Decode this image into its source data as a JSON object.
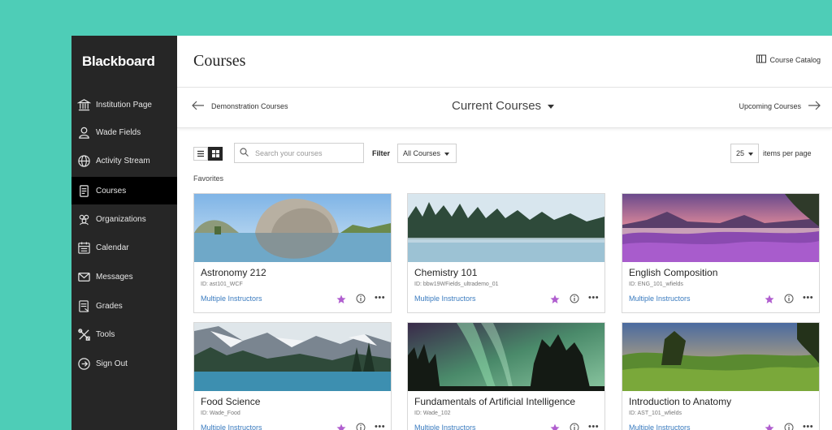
{
  "app": {
    "brand": "Blackboard"
  },
  "sidebar": {
    "items": [
      {
        "label": "Institution Page",
        "icon": "bank-icon"
      },
      {
        "label": "Wade Fields",
        "icon": "user-icon"
      },
      {
        "label": "Activity Stream",
        "icon": "globe-icon"
      },
      {
        "label": "Courses",
        "icon": "book-icon",
        "active": true
      },
      {
        "label": "Organizations",
        "icon": "group-icon"
      },
      {
        "label": "Calendar",
        "icon": "calendar-icon"
      },
      {
        "label": "Messages",
        "icon": "envelope-icon"
      },
      {
        "label": "Grades",
        "icon": "grades-icon"
      },
      {
        "label": "Tools",
        "icon": "tools-icon"
      },
      {
        "label": "Sign Out",
        "icon": "sign-out-icon"
      }
    ]
  },
  "header": {
    "title": "Courses",
    "catalog_label": "Course Catalog"
  },
  "terms": {
    "previous": "Demonstration Courses",
    "current": "Current Courses",
    "next": "Upcoming Courses"
  },
  "toolbar": {
    "search_placeholder": "Search your courses",
    "filter_label": "Filter",
    "filter_value": "All Courses",
    "per_page_value": "25",
    "per_page_label": "items per page"
  },
  "section": {
    "favorites_label": "Favorites"
  },
  "courses": [
    {
      "title": "Astronomy 212",
      "id": "ID: ast101_WCF",
      "instructors": "Multiple Instructors",
      "favorite": true
    },
    {
      "title": "Chemistry 101",
      "id": "ID: bbw19WFields_ultrademo_01",
      "instructors": "Multiple Instructors",
      "favorite": true
    },
    {
      "title": "English Composition",
      "id": "ID: ENG_101_wfields",
      "instructors": "Multiple Instructors",
      "favorite": true
    },
    {
      "title": "Food Science",
      "id": "ID: Wade_Food",
      "instructors": "Multiple Instructors",
      "favorite": true
    },
    {
      "title": "Fundamentals of Artificial Intelligence",
      "id": "ID: Wade_102",
      "instructors": "Multiple Instructors",
      "favorite": true
    },
    {
      "title": "Introduction to Anatomy",
      "id": "ID: AST_101_wfields",
      "instructors": "Multiple Instructors",
      "favorite": true
    }
  ],
  "colors": {
    "background": "#4ecdb7",
    "sidebar": "#262626",
    "accent_link": "#3a7bbf",
    "favorite_star": "#b05ecf"
  }
}
